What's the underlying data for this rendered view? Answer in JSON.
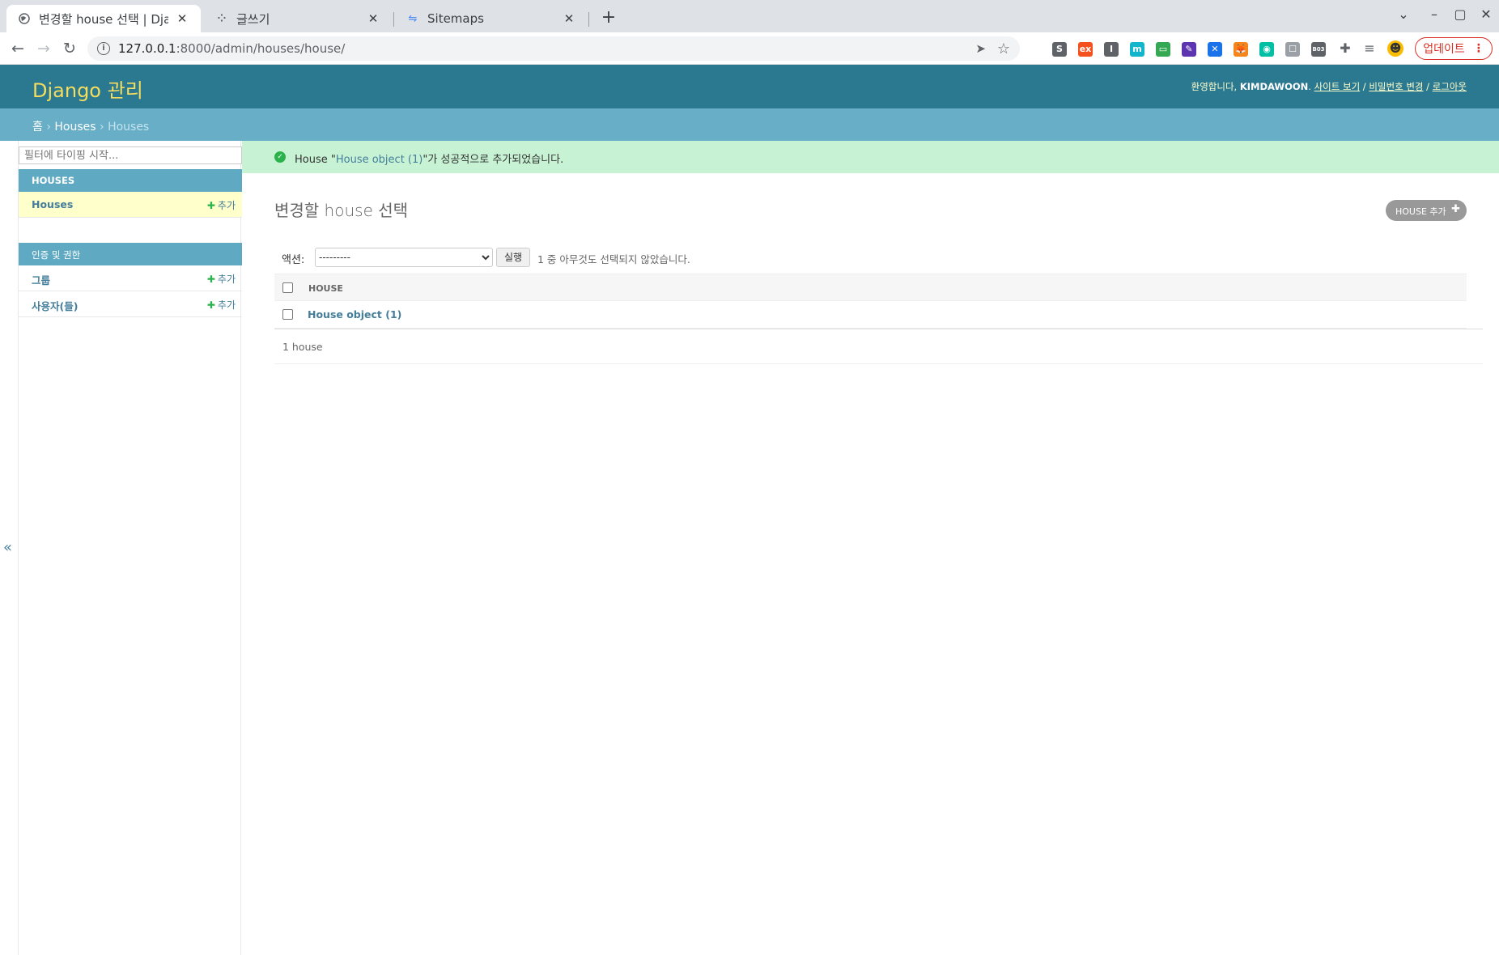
{
  "browser": {
    "tabs": [
      {
        "title": "변경할 house 선택 | Djang",
        "active": true
      },
      {
        "title": "글쓰기",
        "active": false
      },
      {
        "title": "Sitemaps",
        "active": false
      }
    ],
    "url_host": "127.0.0.1",
    "url_path": ":8000/admin/houses/house/",
    "update_label": "업데이트",
    "extensions": [
      {
        "name": "s-ext-icon",
        "label": "S",
        "color": "#5f6368"
      },
      {
        "name": "ex-ext-icon",
        "label": "ex",
        "color": "#f4511e"
      },
      {
        "name": "i-ext-icon",
        "label": "I",
        "color": "#5f6368"
      },
      {
        "name": "m-ext-icon",
        "label": "m",
        "color": "#12b5cb"
      },
      {
        "name": "screen-ext-icon",
        "label": "▭",
        "color": "#34a853"
      },
      {
        "name": "note-ext-icon",
        "label": "✎",
        "color": "#5e35b1"
      },
      {
        "name": "puzzle-blue-ext-icon",
        "label": "✕",
        "color": "#1a73e8"
      },
      {
        "name": "fox-ext-icon",
        "label": "🦊",
        "color": "#f6851b"
      },
      {
        "name": "circle-ext-icon",
        "label": "◉",
        "color": "#00bfa5"
      },
      {
        "name": "ghost-ext-icon",
        "label": "☐",
        "color": "#9aa0a6"
      },
      {
        "name": "b03-ext-icon",
        "label": "B03",
        "color": "#5f6368"
      }
    ]
  },
  "header": {
    "brand": "Django 관리",
    "welcome": "환영합니다,",
    "username": "KIMDAWOON",
    "links": [
      "사이트 보기",
      "비밀번호 변경",
      "로그아웃"
    ]
  },
  "breadcrumbs": {
    "home": "홈",
    "app": "Houses",
    "current": "Houses"
  },
  "sidebar": {
    "filter_placeholder": "필터에 타이핑 시작...",
    "modules": [
      {
        "caption": "HOUSES",
        "models": [
          {
            "label": "Houses",
            "add": "추가",
            "current": true
          }
        ]
      },
      {
        "caption": "인증 및 권한",
        "models": [
          {
            "label": "그룹",
            "add": "추가"
          },
          {
            "label": "사용자(들)",
            "add": "추가"
          }
        ]
      }
    ],
    "collapse_glyph": "«"
  },
  "messages": {
    "prefix": "House \"",
    "object_link": "House object (1)",
    "suffix": "\"가 성공적으로 추가되었습니다."
  },
  "content": {
    "title": "변경할 house 선택",
    "add_button": "HOUSE 추가",
    "action_label": "액션:",
    "action_default": "---------",
    "go_button": "실행",
    "counter": "1 중 아무것도 선택되지 않았습니다.",
    "column_header": "HOUSE",
    "rows": [
      "House object (1)"
    ],
    "paginator": "1 house"
  }
}
